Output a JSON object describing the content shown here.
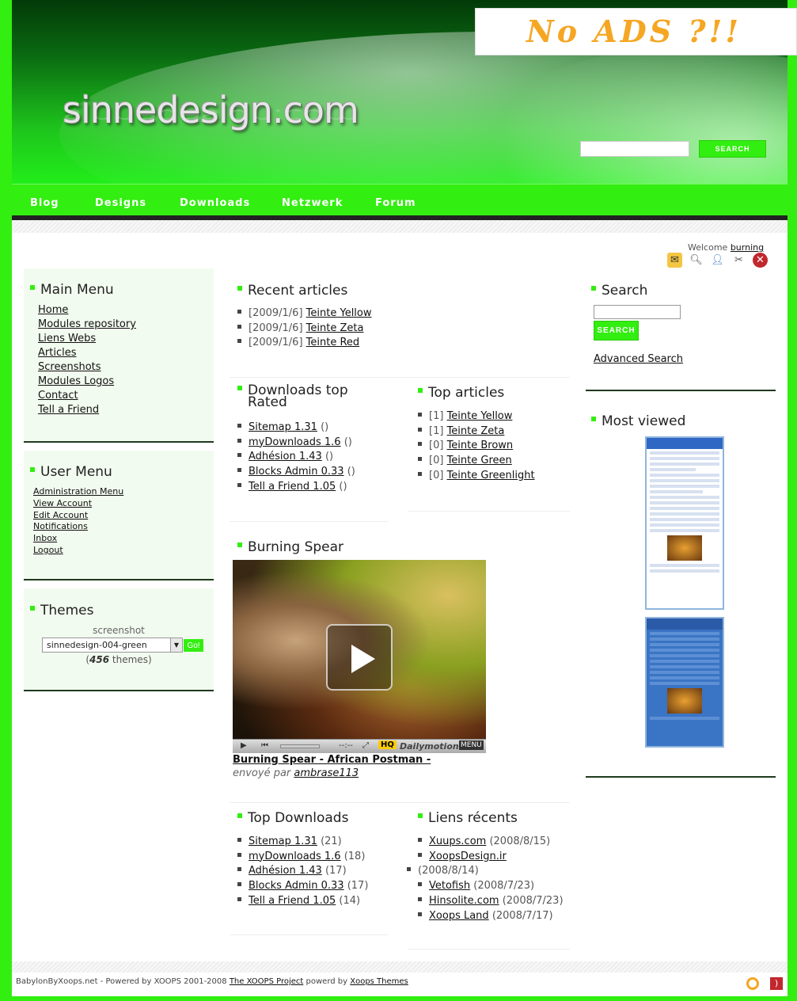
{
  "ad": {
    "text": "No ADS ?!!"
  },
  "header": {
    "logo": "sinnedesign.com",
    "search_button": "Search"
  },
  "nav": [
    "Blog",
    "Designs",
    "Downloads",
    "Netzwerk",
    "Forum"
  ],
  "welcome": {
    "prefix": "Welcome",
    "username": "burning"
  },
  "main_menu": {
    "title": "Main Menu",
    "items": [
      "Home",
      "Modules repository",
      "Liens Webs",
      "Articles",
      "Screenshots",
      "Modules Logos",
      "Contact",
      "Tell a Friend"
    ]
  },
  "user_menu": {
    "title": "User Menu",
    "items": [
      "Administration Menu",
      "View Account",
      "Edit Account",
      "Notifications",
      "Inbox",
      "Logout"
    ]
  },
  "themes": {
    "title": "Themes",
    "screenshot_label": "screenshot",
    "selected": "sinnedesign-004-green",
    "go_button": "Go!",
    "count_open": "(",
    "count": "456",
    "count_suffix": " themes)"
  },
  "recent_articles": {
    "title": "Recent articles",
    "items": [
      {
        "date": "[2009/1/6]",
        "title": "Teinte Yellow"
      },
      {
        "date": "[2009/1/6]",
        "title": "Teinte Zeta"
      },
      {
        "date": "[2009/1/6]",
        "title": "Teinte Red"
      }
    ]
  },
  "downloads_top_rated": {
    "title_line1": "Downloads top",
    "title_line2": "Rated",
    "items": [
      {
        "name": "Sitemap 1.31",
        "extra": "()"
      },
      {
        "name": "myDownloads 1.6",
        "extra": "()"
      },
      {
        "name": "Adhésion 1.43",
        "extra": "()"
      },
      {
        "name": "Blocks Admin 0.33",
        "extra": "()"
      },
      {
        "name": "Tell a Friend 1.05",
        "extra": "()"
      }
    ]
  },
  "top_articles": {
    "title": "Top articles",
    "items": [
      {
        "count": "[1]",
        "title": "Teinte Yellow"
      },
      {
        "count": "[1]",
        "title": "Teinte Zeta"
      },
      {
        "count": "[0]",
        "title": "Teinte Brown"
      },
      {
        "count": "[0]",
        "title": "Teinte Green"
      },
      {
        "count": "[0]",
        "title": "Teinte Greenlight"
      }
    ]
  },
  "video_block": {
    "title": "Burning Spear",
    "bar_time": "--:--",
    "bar_hq": "HQ",
    "bar_brand": "Dailymotion",
    "bar_menu": "MENU",
    "link": "Burning Spear - African Postman -",
    "sent_by_prefix": "envoyé par",
    "sent_by_user": "ambrase113"
  },
  "top_downloads": {
    "title": "Top Downloads",
    "items": [
      {
        "name": "Sitemap 1.31",
        "extra": "(21)"
      },
      {
        "name": "myDownloads 1.6",
        "extra": "(18)"
      },
      {
        "name": "Adhésion 1.43",
        "extra": "(17)"
      },
      {
        "name": "Blocks Admin 0.33",
        "extra": "(17)"
      },
      {
        "name": "Tell a Friend 1.05",
        "extra": "(14)"
      }
    ]
  },
  "recent_links": {
    "title": "Liens récents",
    "items": [
      {
        "name": "Xuups.com",
        "date": "(2008/8/15)"
      },
      {
        "name": "XoopsDesign.ir",
        "date": "(2008/8/14)"
      },
      {
        "name": "Vetofish",
        "date": "(2008/7/23)"
      },
      {
        "name": "Hinsolite.com",
        "date": "(2008/7/23)"
      },
      {
        "name": "Xoops Land",
        "date": "(2008/7/17)"
      }
    ]
  },
  "search_block": {
    "title": "Search",
    "button": "Search",
    "advanced": "Advanced Search"
  },
  "most_viewed": {
    "title": "Most viewed"
  },
  "footer": {
    "text1": "BabylonByXoops.net - Powered by XOOPS 2001-2008",
    "link1": "The XOOPS Project",
    "text2": "powerd by",
    "link2": "Xoops Themes"
  },
  "colors": {
    "accent": "#33ee11",
    "header_dark": "#033a08"
  }
}
